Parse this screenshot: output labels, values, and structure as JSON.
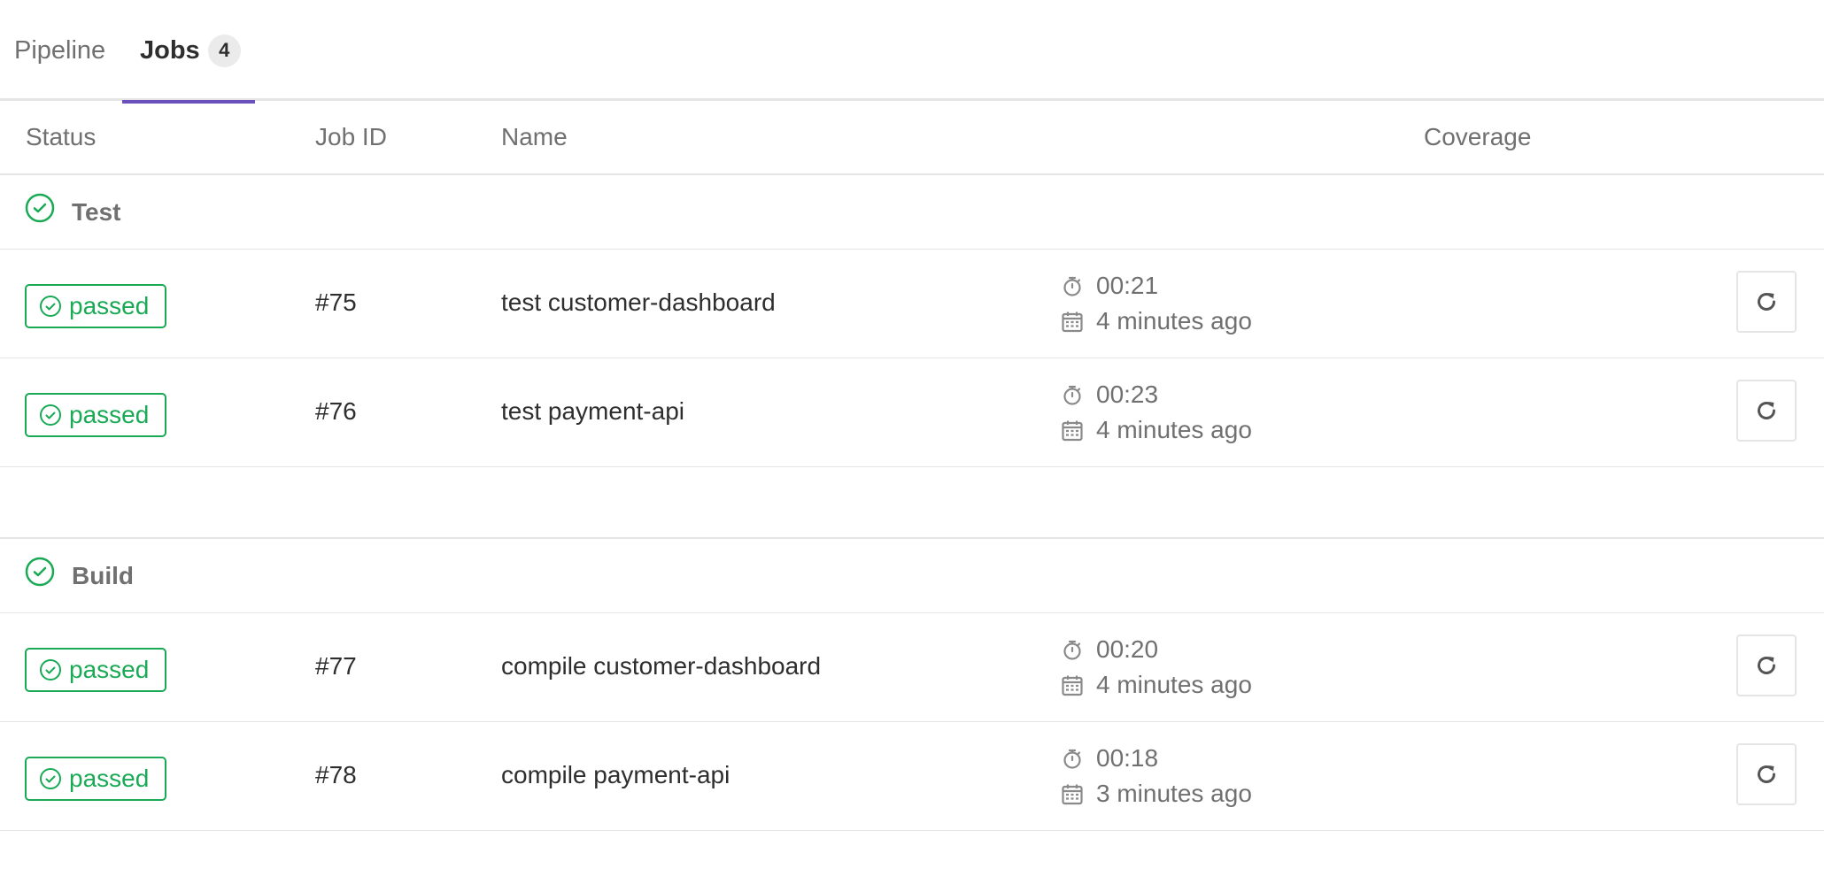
{
  "tabs": {
    "pipeline_label": "Pipeline",
    "jobs_label": "Jobs",
    "jobs_count": "4",
    "active_color": "#6b4fbb"
  },
  "table_header": {
    "status": "Status",
    "job_id": "Job ID",
    "name": "Name",
    "coverage": "Coverage"
  },
  "stages": [
    {
      "name": "Test",
      "status_icon": "check-circle-icon",
      "jobs": [
        {
          "status": "passed",
          "id": "#75",
          "name": "test customer-dashboard",
          "duration": "00:21",
          "finished": "4 minutes ago"
        },
        {
          "status": "passed",
          "id": "#76",
          "name": "test payment-api",
          "duration": "00:23",
          "finished": "4 minutes ago"
        }
      ]
    },
    {
      "name": "Build",
      "status_icon": "check-circle-icon",
      "jobs": [
        {
          "status": "passed",
          "id": "#77",
          "name": "compile customer-dashboard",
          "duration": "00:20",
          "finished": "4 minutes ago"
        },
        {
          "status": "passed",
          "id": "#78",
          "name": "compile payment-api",
          "duration": "00:18",
          "finished": "3 minutes ago"
        }
      ]
    }
  ],
  "colors": {
    "success": "#1aaa55",
    "muted_text": "#707070",
    "border": "#e5e5e5"
  }
}
